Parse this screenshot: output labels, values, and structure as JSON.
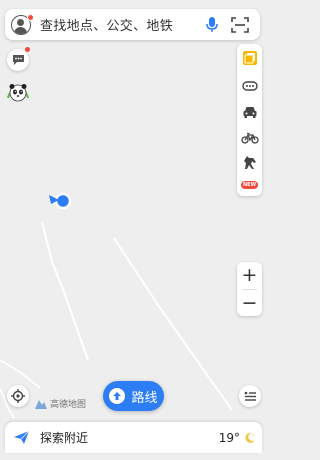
{
  "search": {
    "placeholder": "查找地点、公交、地铁"
  },
  "toolbar": {
    "items": [
      {
        "icon": "layers-icon"
      },
      {
        "icon": "more-icon"
      },
      {
        "icon": "car-icon"
      },
      {
        "icon": "bicycle-icon"
      },
      {
        "icon": "horse-icon"
      },
      {
        "icon": "new-badge",
        "badge": "NEW"
      }
    ]
  },
  "zoom": {
    "in_label": "+",
    "out_label": "−"
  },
  "route_button": {
    "label": "路线"
  },
  "map": {
    "attribution": "高德地图"
  },
  "bottom": {
    "label": "探索附近",
    "temperature": "19°"
  },
  "colors": {
    "accent": "#2d7df6",
    "badge_red": "#f24a3c",
    "map_bg": "#eeeeee"
  }
}
